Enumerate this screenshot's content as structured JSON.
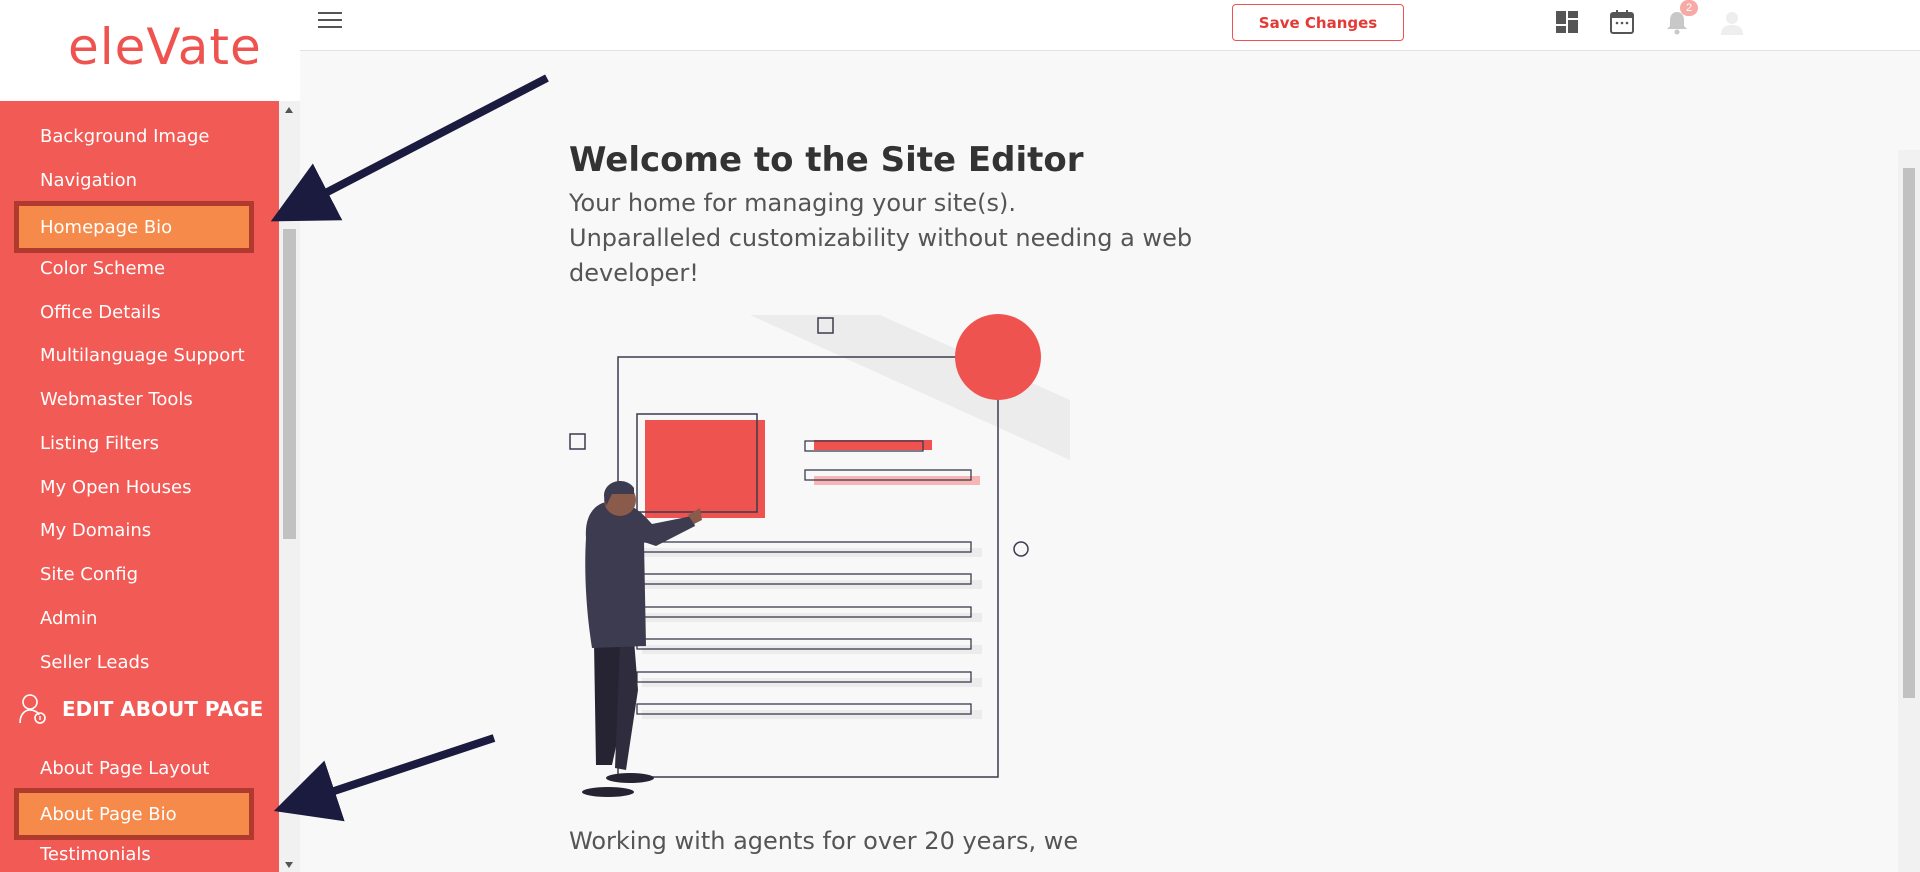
{
  "brand": {
    "logo_text": "eleVate"
  },
  "sidebar": {
    "items": [
      {
        "label": "Background Image"
      },
      {
        "label": "Navigation"
      },
      {
        "label": "Homepage Bio"
      },
      {
        "label": "Color Scheme"
      },
      {
        "label": "Office Details"
      },
      {
        "label": "Multilanguage Support"
      },
      {
        "label": "Webmaster Tools"
      },
      {
        "label": "Listing Filters"
      },
      {
        "label": "My Open Houses"
      },
      {
        "label": "My Domains"
      },
      {
        "label": "Site Config"
      },
      {
        "label": "Admin"
      },
      {
        "label": "Seller Leads"
      }
    ],
    "section_heading": "EDIT ABOUT PAGE",
    "about_items": [
      {
        "label": "About Page Layout"
      },
      {
        "label": "About Page Bio"
      },
      {
        "label": "Testimonials"
      }
    ]
  },
  "header": {
    "save_label": "Save Changes",
    "notification_count": "2",
    "icons": [
      "menu-icon",
      "dashboard-icon",
      "calendar-icon",
      "bell-icon",
      "avatar-icon"
    ]
  },
  "main": {
    "title": "Welcome to the Site Editor",
    "subtitle_lines": [
      "Your home for managing your site(s).",
      "Unparalleled customizability without needing a web",
      "developer!"
    ],
    "bottom_text": "Working with agents for over 20 years, we"
  },
  "colors": {
    "sidebar_bg": "#f25a55",
    "highlight_bg": "#f58a4a",
    "highlight_border": "#b03a2e",
    "accent": "#ef5350",
    "arrow": "#1b1a3f"
  }
}
